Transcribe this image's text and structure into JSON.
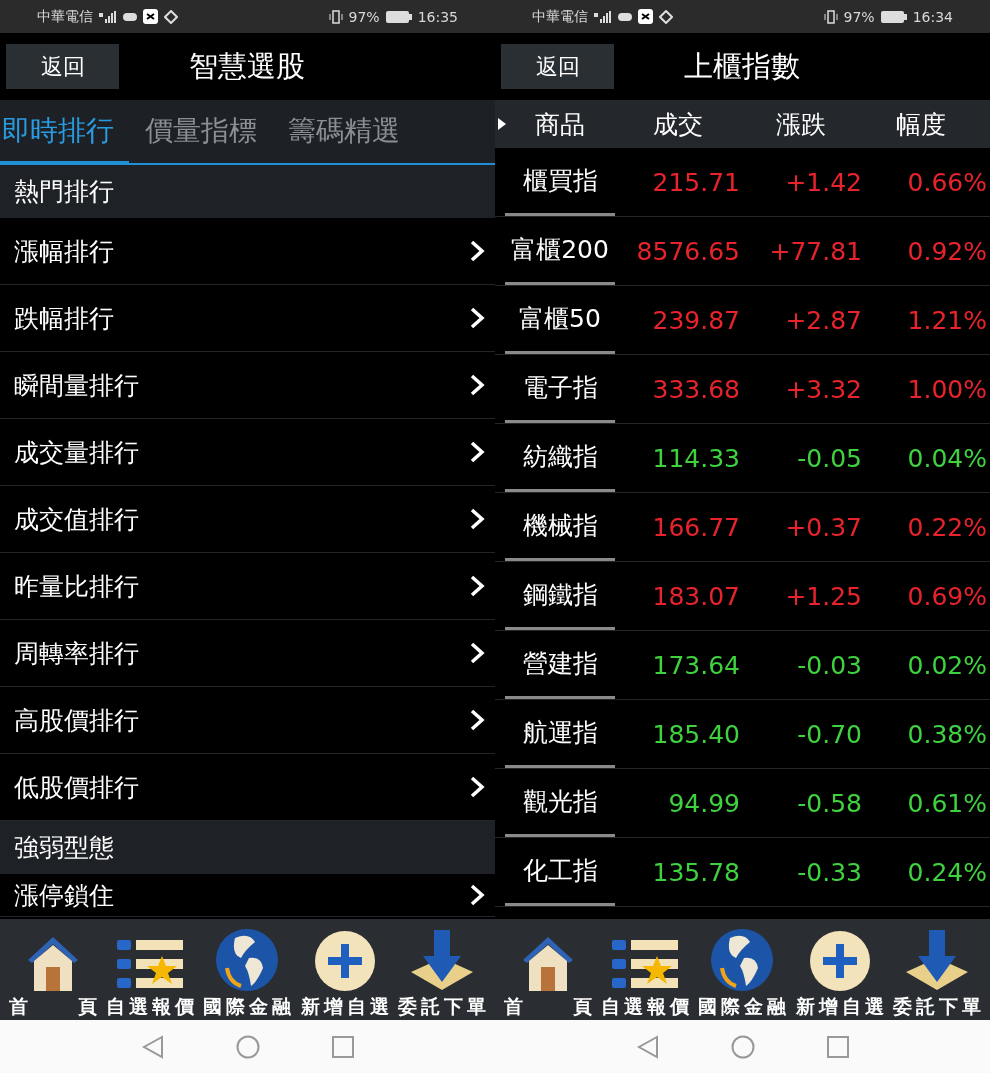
{
  "screens": [
    {
      "kind": "menu",
      "status_bar": {
        "carrier": "中華電信",
        "battery": "97%",
        "time": "16:35"
      },
      "header": {
        "back_button": "返回",
        "title": "智慧選股"
      },
      "tabs": [
        {
          "label": "即時排行",
          "selected": true
        },
        {
          "label": "價量指標",
          "selected": false
        },
        {
          "label": "籌碼精選",
          "selected": false
        }
      ],
      "sections": [
        {
          "title": "熱門排行",
          "items": [
            "漲幅排行",
            "跌幅排行",
            "瞬間量排行",
            "成交量排行",
            "成交值排行",
            "昨量比排行",
            "周轉率排行",
            "高股價排行",
            "低股價排行"
          ]
        },
        {
          "title": "強弱型態",
          "items": [
            "漲停鎖住"
          ]
        }
      ],
      "bottom_nav": [
        "首頁",
        "自選報價",
        "國際金融",
        "新增自選",
        "委託下單"
      ]
    },
    {
      "kind": "table",
      "status_bar": {
        "carrier": "中華電信",
        "battery": "97%",
        "time": "16:34"
      },
      "header": {
        "back_button": "返回",
        "title": "上櫃指數"
      },
      "table": {
        "columns": [
          "商品",
          "成交",
          "漲跌",
          "幅度"
        ],
        "rows": [
          {
            "name": "櫃買指",
            "price": "215.71",
            "change": "+1.42",
            "percent": "0.66%",
            "color": "#e8232b"
          },
          {
            "name": "富櫃200",
            "price": "8576.65",
            "change": "+77.81",
            "percent": "0.92%",
            "color": "#e8232b"
          },
          {
            "name": "富櫃50",
            "price": "239.87",
            "change": "+2.87",
            "percent": "1.21%",
            "color": "#e8232b"
          },
          {
            "name": "電子指",
            "price": "333.68",
            "change": "+3.32",
            "percent": "1.00%",
            "color": "#e8232b"
          },
          {
            "name": "紡織指",
            "price": "114.33",
            "change": "-0.05",
            "percent": "0.04%",
            "color": "#3fd23f"
          },
          {
            "name": "機械指",
            "price": "166.77",
            "change": "+0.37",
            "percent": "0.22%",
            "color": "#e8232b"
          },
          {
            "name": "鋼鐵指",
            "price": "183.07",
            "change": "+1.25",
            "percent": "0.69%",
            "color": "#e8232b"
          },
          {
            "name": "營建指",
            "price": "173.64",
            "change": "-0.03",
            "percent": "0.02%",
            "color": "#3fd23f"
          },
          {
            "name": "航運指",
            "price": "185.40",
            "change": "-0.70",
            "percent": "0.38%",
            "color": "#3fd23f"
          },
          {
            "name": "觀光指",
            "price": "94.99",
            "change": "-0.58",
            "percent": "0.61%",
            "color": "#3fd23f"
          },
          {
            "name": "化工指",
            "price": "135.78",
            "change": "-0.33",
            "percent": "0.24%",
            "color": "#3fd23f"
          }
        ]
      },
      "bottom_nav": [
        "首頁",
        "自選報價",
        "國際金融",
        "新增自選",
        "委託下單"
      ]
    }
  ]
}
